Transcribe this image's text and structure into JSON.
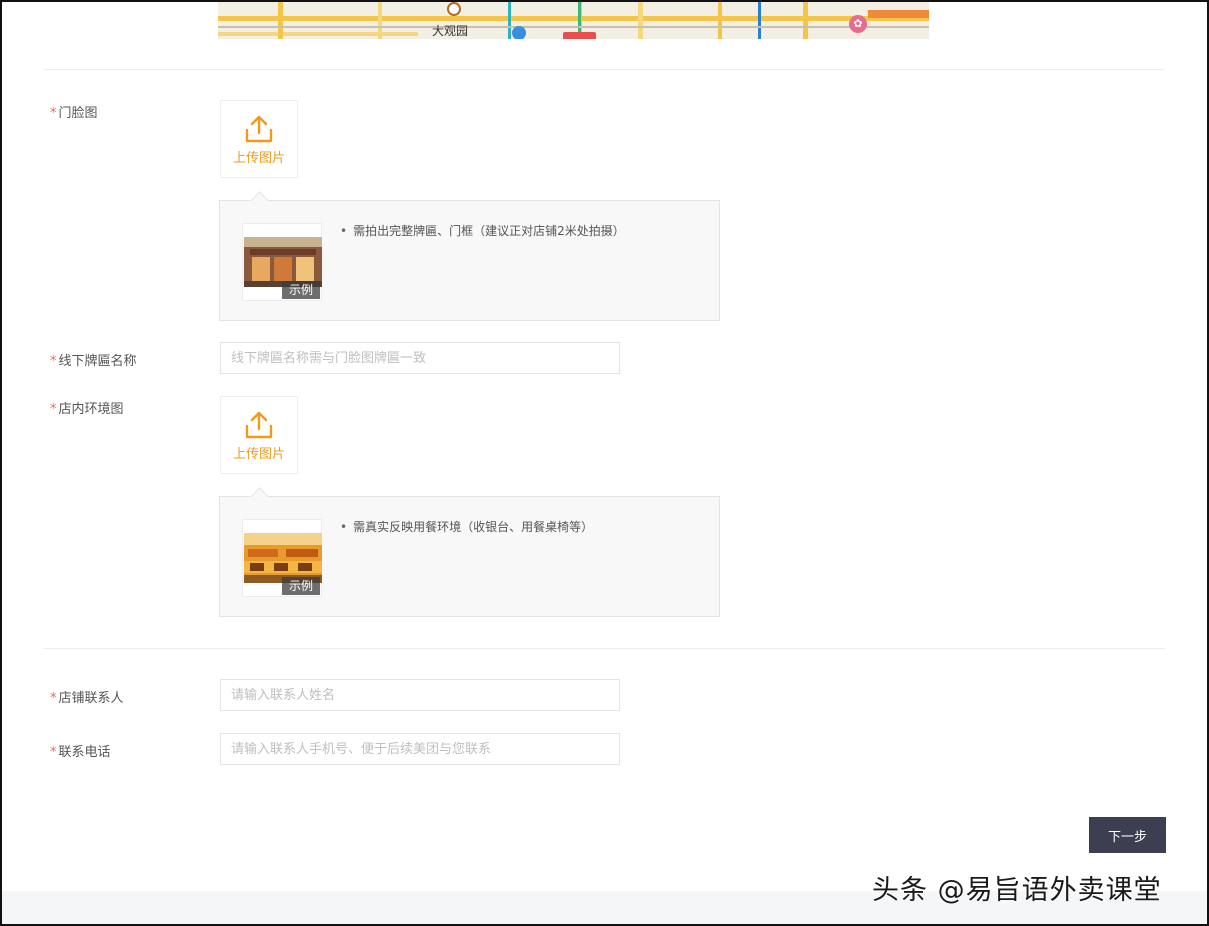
{
  "map": {
    "place_label": "大观园"
  },
  "storefront": {
    "label": "门脸图",
    "upload_text": "上传图片",
    "example_tag": "示例",
    "tip": "需拍出完整牌匾、门框（建议正对店铺2米处拍摄）"
  },
  "sign_name": {
    "label": "线下牌匾名称",
    "placeholder": "线下牌匾名称需与门脸图牌匾一致",
    "value": ""
  },
  "interior": {
    "label": "店内环境图",
    "upload_text": "上传图片",
    "example_tag": "示例",
    "tip": "需真实反映用餐环境（收银台、用餐桌椅等）"
  },
  "contact": {
    "label": "店铺联系人",
    "placeholder": "请输入联系人姓名",
    "value": ""
  },
  "phone": {
    "label": "联系电话",
    "placeholder": "请输入联系人手机号、便于后续美团与您联系",
    "value": ""
  },
  "required_mark": "*",
  "next_button": "下一步",
  "watermark": "头条 @易旨语外卖课堂",
  "colors": {
    "accent": "#f29b1a",
    "required": "#e96a5b",
    "button": "#3c3f52"
  }
}
